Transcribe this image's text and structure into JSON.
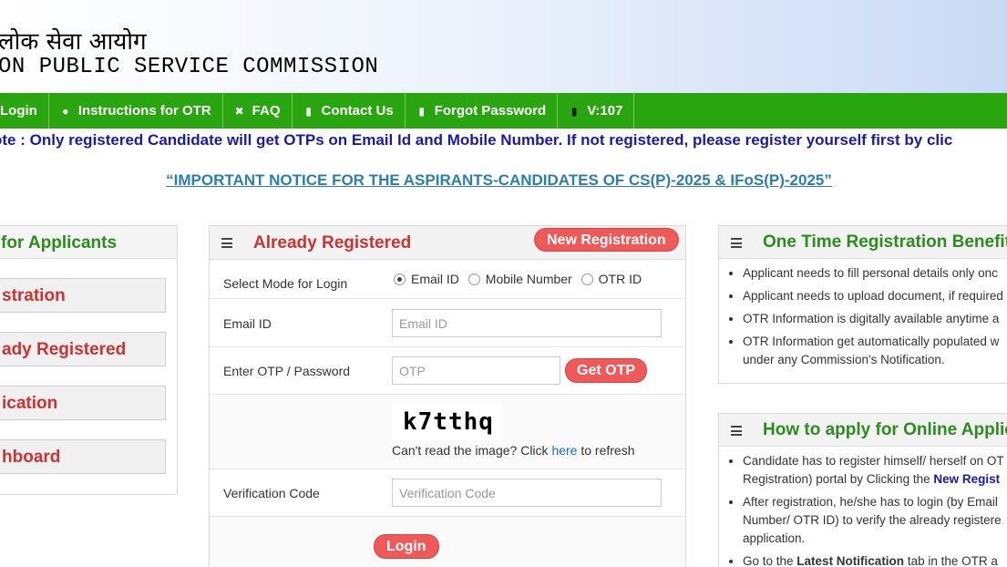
{
  "header": {
    "hindi_title": "लोक सेवा आयोग",
    "english_title": "ON PUBLIC SERVICE COMMISSION"
  },
  "nav": [
    {
      "label": "Login",
      "icon": "none"
    },
    {
      "label": "Instructions for OTR",
      "icon": "globe-icon"
    },
    {
      "label": "FAQ",
      "icon": "expand-icon"
    },
    {
      "label": "Contact Us",
      "icon": "document-icon"
    },
    {
      "label": "Forgot Password",
      "icon": "document-icon"
    },
    {
      "label": "V:107",
      "icon": "mobile-icon"
    }
  ],
  "marquee": "ote : Only registered Candidate will get OTPs on Email Id and Mobile Number. If not registered, please register yourself first by clic",
  "notice": "“IMPORTANT NOTICE FOR THE ASPIRANTS-CANDIDATES OF CS(P)-2025 & IFoS(P)-2025”",
  "left_panel": {
    "title": "for Applicants",
    "buttons": [
      "stration",
      "ady Registered",
      "ication",
      "hboard"
    ]
  },
  "login_panel": {
    "title": "Already Registered",
    "new_registration": "New Registration",
    "mode_label": "Select Mode for Login",
    "mode_options": [
      "Email ID",
      "Mobile Number",
      "OTR ID"
    ],
    "mode_selected": "Email ID",
    "email_label": "Email ID",
    "email_placeholder": "Email ID",
    "otp_label": "Enter OTP / Password",
    "otp_placeholder": "OTP",
    "get_otp": "Get OTP",
    "captcha_text": "k7tthq",
    "refresh_prefix": "Can't read the image? Click ",
    "refresh_link": "here",
    "refresh_suffix": " to refresh",
    "verification_label": "Verification Code",
    "verification_placeholder": "Verification Code",
    "login_button": "Login"
  },
  "otr_benefits": {
    "title": "One Time Registration Benefit",
    "items": [
      "Applicant needs to fill personal details only onc",
      "Applicant needs to upload document, if required",
      "OTR Information is digitally available anytime a",
      "OTR Information get automatically populated w",
      "under any Commission's Notification."
    ]
  },
  "how_to_apply": {
    "title": "How to apply for Online Applic",
    "items": [
      "Candidate has to register himself/ herself on OT",
      "Registration) portal by Clicking the ",
      "New Regist",
      "After registration, he/she has to login (by Email",
      "Number/ OTR ID) to verify the already registere",
      "application.",
      "Go to the ",
      "Latest Notification",
      " tab in the OTR a"
    ]
  },
  "colors": {
    "nav_green": "#29a60f",
    "heading_red": "#cc3333",
    "heading_green": "#2c8c1e",
    "notice_blue": "#2a7fb0",
    "marquee_blue": "#1a1aaa",
    "button_red": "#ee5a5a"
  }
}
